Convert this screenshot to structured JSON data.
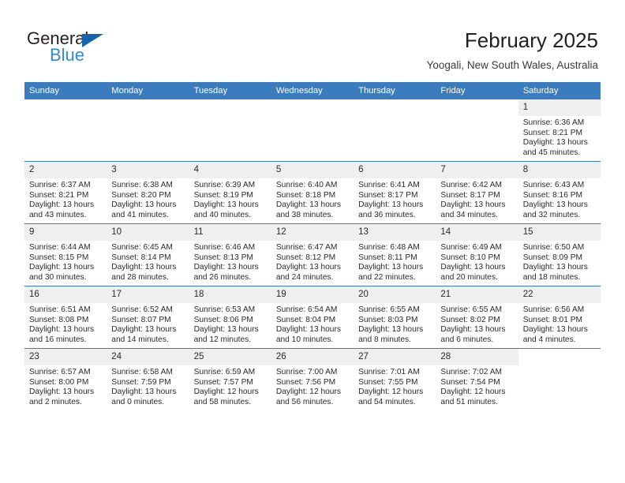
{
  "branding": {
    "name_top": "General",
    "name_bottom": "Blue",
    "triangle_color": "#1565a8",
    "blue_color": "#2e8bd4"
  },
  "header": {
    "title": "February 2025",
    "subtitle": "Yoogali, New South Wales, Australia"
  },
  "theme": {
    "header_row_bg": "#3a7cbe",
    "daynum_bg": "#efefef",
    "grid_line": "#3a7cbe"
  },
  "weekday_headers": [
    "Sunday",
    "Monday",
    "Tuesday",
    "Wednesday",
    "Thursday",
    "Friday",
    "Saturday"
  ],
  "labels": {
    "sunrise": "Sunrise:",
    "sunset": "Sunset:",
    "daylight": "Daylight:"
  },
  "weeks": [
    [
      {
        "day": "",
        "blank": true
      },
      {
        "day": "",
        "blank": true
      },
      {
        "day": "",
        "blank": true
      },
      {
        "day": "",
        "blank": true
      },
      {
        "day": "",
        "blank": true
      },
      {
        "day": "",
        "blank": true
      },
      {
        "day": "1",
        "sunrise": "Sunrise: 6:36 AM",
        "sunset": "Sunset: 8:21 PM",
        "daylight_1": "Daylight: 13 hours",
        "daylight_2": "and 45 minutes."
      }
    ],
    [
      {
        "day": "2",
        "sunrise": "Sunrise: 6:37 AM",
        "sunset": "Sunset: 8:21 PM",
        "daylight_1": "Daylight: 13 hours",
        "daylight_2": "and 43 minutes."
      },
      {
        "day": "3",
        "sunrise": "Sunrise: 6:38 AM",
        "sunset": "Sunset: 8:20 PM",
        "daylight_1": "Daylight: 13 hours",
        "daylight_2": "and 41 minutes."
      },
      {
        "day": "4",
        "sunrise": "Sunrise: 6:39 AM",
        "sunset": "Sunset: 8:19 PM",
        "daylight_1": "Daylight: 13 hours",
        "daylight_2": "and 40 minutes."
      },
      {
        "day": "5",
        "sunrise": "Sunrise: 6:40 AM",
        "sunset": "Sunset: 8:18 PM",
        "daylight_1": "Daylight: 13 hours",
        "daylight_2": "and 38 minutes."
      },
      {
        "day": "6",
        "sunrise": "Sunrise: 6:41 AM",
        "sunset": "Sunset: 8:17 PM",
        "daylight_1": "Daylight: 13 hours",
        "daylight_2": "and 36 minutes."
      },
      {
        "day": "7",
        "sunrise": "Sunrise: 6:42 AM",
        "sunset": "Sunset: 8:17 PM",
        "daylight_1": "Daylight: 13 hours",
        "daylight_2": "and 34 minutes."
      },
      {
        "day": "8",
        "sunrise": "Sunrise: 6:43 AM",
        "sunset": "Sunset: 8:16 PM",
        "daylight_1": "Daylight: 13 hours",
        "daylight_2": "and 32 minutes."
      }
    ],
    [
      {
        "day": "9",
        "sunrise": "Sunrise: 6:44 AM",
        "sunset": "Sunset: 8:15 PM",
        "daylight_1": "Daylight: 13 hours",
        "daylight_2": "and 30 minutes."
      },
      {
        "day": "10",
        "sunrise": "Sunrise: 6:45 AM",
        "sunset": "Sunset: 8:14 PM",
        "daylight_1": "Daylight: 13 hours",
        "daylight_2": "and 28 minutes."
      },
      {
        "day": "11",
        "sunrise": "Sunrise: 6:46 AM",
        "sunset": "Sunset: 8:13 PM",
        "daylight_1": "Daylight: 13 hours",
        "daylight_2": "and 26 minutes."
      },
      {
        "day": "12",
        "sunrise": "Sunrise: 6:47 AM",
        "sunset": "Sunset: 8:12 PM",
        "daylight_1": "Daylight: 13 hours",
        "daylight_2": "and 24 minutes."
      },
      {
        "day": "13",
        "sunrise": "Sunrise: 6:48 AM",
        "sunset": "Sunset: 8:11 PM",
        "daylight_1": "Daylight: 13 hours",
        "daylight_2": "and 22 minutes."
      },
      {
        "day": "14",
        "sunrise": "Sunrise: 6:49 AM",
        "sunset": "Sunset: 8:10 PM",
        "daylight_1": "Daylight: 13 hours",
        "daylight_2": "and 20 minutes."
      },
      {
        "day": "15",
        "sunrise": "Sunrise: 6:50 AM",
        "sunset": "Sunset: 8:09 PM",
        "daylight_1": "Daylight: 13 hours",
        "daylight_2": "and 18 minutes."
      }
    ],
    [
      {
        "day": "16",
        "sunrise": "Sunrise: 6:51 AM",
        "sunset": "Sunset: 8:08 PM",
        "daylight_1": "Daylight: 13 hours",
        "daylight_2": "and 16 minutes."
      },
      {
        "day": "17",
        "sunrise": "Sunrise: 6:52 AM",
        "sunset": "Sunset: 8:07 PM",
        "daylight_1": "Daylight: 13 hours",
        "daylight_2": "and 14 minutes."
      },
      {
        "day": "18",
        "sunrise": "Sunrise: 6:53 AM",
        "sunset": "Sunset: 8:06 PM",
        "daylight_1": "Daylight: 13 hours",
        "daylight_2": "and 12 minutes."
      },
      {
        "day": "19",
        "sunrise": "Sunrise: 6:54 AM",
        "sunset": "Sunset: 8:04 PM",
        "daylight_1": "Daylight: 13 hours",
        "daylight_2": "and 10 minutes."
      },
      {
        "day": "20",
        "sunrise": "Sunrise: 6:55 AM",
        "sunset": "Sunset: 8:03 PM",
        "daylight_1": "Daylight: 13 hours",
        "daylight_2": "and 8 minutes."
      },
      {
        "day": "21",
        "sunrise": "Sunrise: 6:55 AM",
        "sunset": "Sunset: 8:02 PM",
        "daylight_1": "Daylight: 13 hours",
        "daylight_2": "and 6 minutes."
      },
      {
        "day": "22",
        "sunrise": "Sunrise: 6:56 AM",
        "sunset": "Sunset: 8:01 PM",
        "daylight_1": "Daylight: 13 hours",
        "daylight_2": "and 4 minutes."
      }
    ],
    [
      {
        "day": "23",
        "sunrise": "Sunrise: 6:57 AM",
        "sunset": "Sunset: 8:00 PM",
        "daylight_1": "Daylight: 13 hours",
        "daylight_2": "and 2 minutes."
      },
      {
        "day": "24",
        "sunrise": "Sunrise: 6:58 AM",
        "sunset": "Sunset: 7:59 PM",
        "daylight_1": "Daylight: 13 hours",
        "daylight_2": "and 0 minutes."
      },
      {
        "day": "25",
        "sunrise": "Sunrise: 6:59 AM",
        "sunset": "Sunset: 7:57 PM",
        "daylight_1": "Daylight: 12 hours",
        "daylight_2": "and 58 minutes."
      },
      {
        "day": "26",
        "sunrise": "Sunrise: 7:00 AM",
        "sunset": "Sunset: 7:56 PM",
        "daylight_1": "Daylight: 12 hours",
        "daylight_2": "and 56 minutes."
      },
      {
        "day": "27",
        "sunrise": "Sunrise: 7:01 AM",
        "sunset": "Sunset: 7:55 PM",
        "daylight_1": "Daylight: 12 hours",
        "daylight_2": "and 54 minutes."
      },
      {
        "day": "28",
        "sunrise": "Sunrise: 7:02 AM",
        "sunset": "Sunset: 7:54 PM",
        "daylight_1": "Daylight: 12 hours",
        "daylight_2": "and 51 minutes."
      },
      {
        "day": "",
        "blank": true
      }
    ]
  ]
}
